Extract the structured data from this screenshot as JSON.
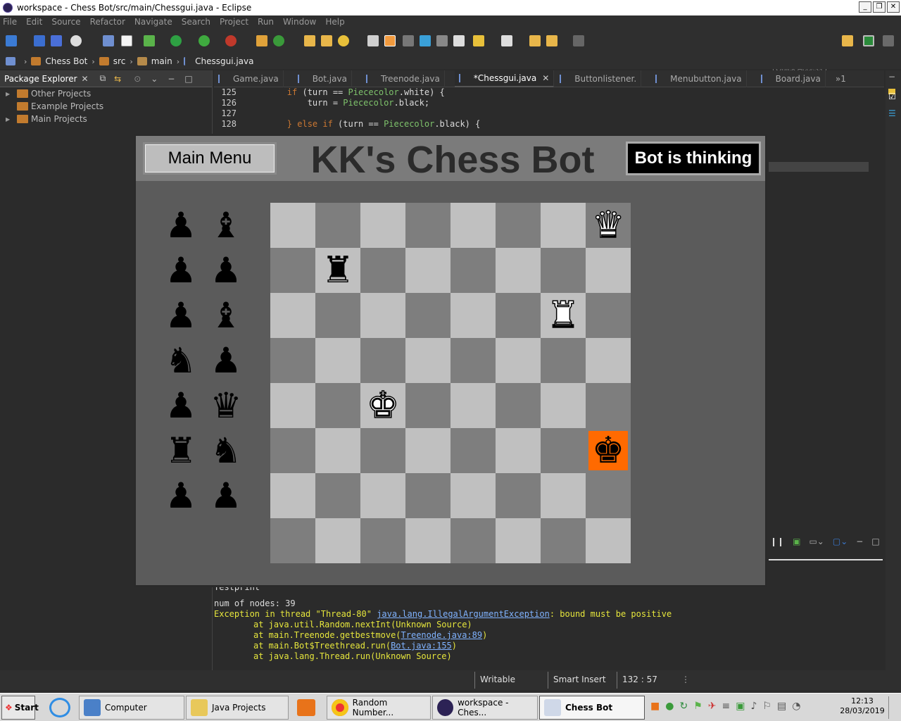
{
  "window": {
    "title": "workspace - Chess Bot/src/main/Chessgui.java - Eclipse"
  },
  "menubar": [
    "File",
    "Edit",
    "Source",
    "Refactor",
    "Navigate",
    "Search",
    "Project",
    "Run",
    "Window",
    "Help"
  ],
  "toolbar": {
    "quick_access_placeholder": "Quick Access"
  },
  "breadcrumb": [
    "Chess Bot",
    "src",
    "main",
    "Chessgui.java"
  ],
  "package_explorer": {
    "title": "Package Explorer",
    "items": [
      "Other Projects",
      "Example Projects",
      "Main Projects"
    ]
  },
  "editor": {
    "tabs": [
      "Game.java",
      "Bot.java",
      "Treenode.java",
      "*Chessgui.java",
      "Buttonlistener.",
      "Menubutton.java",
      "Board.java"
    ],
    "active_tab": "*Chessgui.java",
    "overflow": "»1",
    "lines": [
      {
        "num": "125",
        "indent": "        ",
        "kw": "if",
        "a": " (turn == ",
        "type": "Piececolor",
        "b": ".white) {"
      },
      {
        "num": "126",
        "indent": "            ",
        "kw": "",
        "a": "turn = ",
        "type": "Piececolor",
        "b": ".black;"
      },
      {
        "num": "127",
        "indent": "",
        "kw": "",
        "a": "",
        "type": "",
        "b": ""
      },
      {
        "num": "128",
        "indent": "        ",
        "kw": "} else if",
        "a": " (turn == ",
        "type": "Piececolor",
        "b": ".black) {"
      }
    ]
  },
  "console": {
    "lines": [
      {
        "cls": "cl",
        "text": "Testprint"
      },
      {
        "cls": "cl",
        "text": "num of nodes: 39"
      }
    ],
    "exception": {
      "prefix": "Exception in thread \"Thread-80\" ",
      "link": "java.lang.IllegalArgumentException",
      "suffix": ": bound must be positive"
    },
    "stack": [
      {
        "pre": "\tat java.util.Random.nextInt(Unknown Source)",
        "link": "",
        "post": ""
      },
      {
        "pre": "\tat main.Treenode.getbestmove(",
        "link": "Treenode.java:89",
        "post": ")"
      },
      {
        "pre": "\tat main.Bot$Treethread.run(",
        "link": "Bot.java:155",
        "post": ")"
      },
      {
        "pre": "\tat java.lang.Thread.run(Unknown Source)",
        "link": "",
        "post": ""
      }
    ]
  },
  "statusbar": {
    "writable": "Writable",
    "insert_mode": "Smart Insert",
    "position": "132 : 57"
  },
  "chess_app": {
    "main_menu_label": "Main Menu",
    "title": "KK's Chess Bot",
    "status": "Bot is thinking",
    "board": [
      [
        "",
        "",
        "",
        "",
        "",
        "",
        "",
        "wQ"
      ],
      [
        "",
        "bR",
        "",
        "",
        "",
        "",
        "",
        ""
      ],
      [
        "",
        "",
        "",
        "",
        "",
        "",
        "wR",
        ""
      ],
      [
        "",
        "",
        "",
        "",
        "",
        "",
        "",
        ""
      ],
      [
        "",
        "",
        "wK",
        "",
        "",
        "",
        "",
        ""
      ],
      [
        "",
        "",
        "",
        "",
        "",
        "",
        "",
        "bK"
      ],
      [
        "",
        "",
        "",
        "",
        "",
        "",
        "",
        ""
      ],
      [
        "",
        "",
        "",
        "",
        "",
        "",
        "",
        ""
      ]
    ],
    "highlight": {
      "row": 5,
      "col": 7,
      "color": "#ff6a00"
    },
    "captured": [
      [
        "bP",
        "bB"
      ],
      [
        "bP",
        "bP"
      ],
      [
        "bP",
        "bB"
      ],
      [
        "bN",
        "bP"
      ],
      [
        "bP",
        "bQ"
      ],
      [
        "bR",
        "bN"
      ],
      [
        "bP",
        "bP"
      ]
    ],
    "colors": {
      "light_square": "#c0c0c0",
      "dark_square": "#7e7e7e",
      "panel": "#5b5b5b"
    }
  },
  "taskbar": {
    "start": "Start",
    "tasks": [
      "Computer",
      "Java Projects",
      "Random Number...",
      "workspace - Ches...",
      "Chess Bot"
    ],
    "active_task": "Chess Bot",
    "clock_time": "12:13",
    "clock_date": "28/03/2019"
  }
}
